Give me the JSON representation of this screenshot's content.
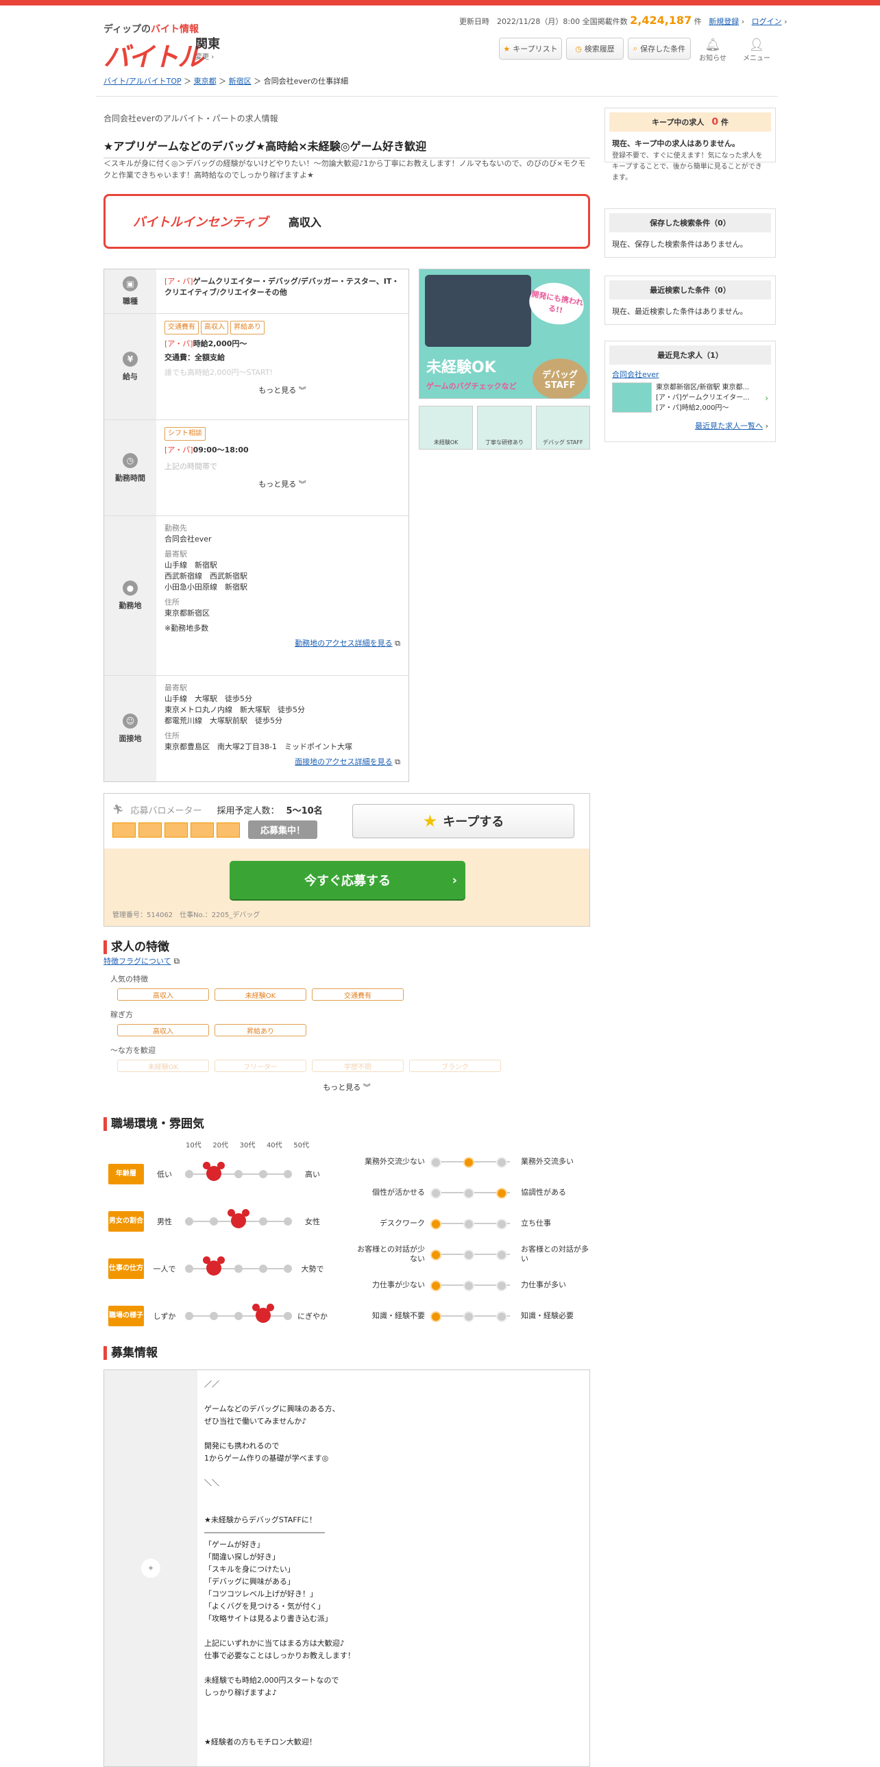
{
  "header": {
    "logo_sub_prefix": "ディップの",
    "logo_sub_accent": "バイト情報",
    "logo": "バイトル",
    "region": "関東",
    "region_change": "変更",
    "update_label": "更新日時　2022/11/28（月）8:00 全国掲載件数",
    "job_count": "2,424,187",
    "count_unit": "件",
    "register": "新規登録",
    "login": "ログイン",
    "btn_keeplist": "キープリスト",
    "btn_history": "検索履歴",
    "btn_saved": "保存した条件",
    "notify": "お知らせ",
    "menu": "メニュー"
  },
  "breadcrumb": {
    "top": "バイト/アルバイトTOP",
    "pref": "東京都",
    "ward": "新宿区",
    "current": "合同会社everの仕事詳細"
  },
  "job": {
    "company_sub": "合同会社everのアルバイト・パートの求人情報",
    "title": "★アプリゲームなどのデバッグ★高時給×未経験◎ゲーム好き歓迎",
    "description": "＜スキルが身に付く◎＞デバッグの経験がないけどやりたい！～勿論大歓迎♪1から丁寧にお教えします！ノルマもないので、のびのび×モクモクと作業できちゃいます！高時給なのでしっかり稼げますよ★",
    "banner_logo": "バイトルインセンティブ",
    "banner_text": "高収入"
  },
  "table": {
    "job_label": "職種",
    "job_type_tag": "[ア・パ]",
    "job_value": "ゲームクリエイター・デバッグ/デバッガー・テスター、IT・クリエイティブ/クリエイターその他",
    "pay_label": "給与",
    "pay_tags": [
      "交通費有",
      "高収入",
      "昇給あり"
    ],
    "pay_type": "[ア・パ]",
    "pay_value": "時給2,000円～",
    "pay_transport": "交通費：全額支給",
    "pay_faded": "誰でも高時給2,000円～START!",
    "more": "もっと見る",
    "time_label": "勤務時間",
    "time_tag": "シフト相談",
    "time_type": "[ア・パ]",
    "time_value": "09:00～18:00",
    "time_faded": "上記の時間帯で",
    "place_label": "勤務地",
    "place_sub1": "勤務先",
    "place_company": "合同会社ever",
    "place_sub2": "最寄駅",
    "place_station1": "山手線　新宿駅",
    "place_station2": "西武新宿線　西武新宿駅",
    "place_station3": "小田急小田原線　新宿駅",
    "place_sub3": "住所",
    "place_address": "東京都新宿区",
    "place_note": "※勤務地多数",
    "place_access": "勤務地のアクセス詳細を見る",
    "interview_label": "面接地",
    "iv_sub1": "最寄駅",
    "iv_station1": "山手線　大塚駅　徒歩5分",
    "iv_station2": "東京メトロ丸ノ内線　新大塚駅　徒歩5分",
    "iv_station3": "都電荒川線　大塚駅前駅　徒歩5分",
    "iv_sub2": "住所",
    "iv_address": "東京都豊島区　南大塚2丁目38-1　ミッドポイント大塚",
    "iv_access": "面接地のアクセス詳細を見る"
  },
  "gallery": {
    "badge": "開発にも携われる!!",
    "headline": "未経験OK",
    "caption": "ゲームのバグチェックなど",
    "staff": "デバッグ STAFF",
    "thumbs": [
      "未経験OK",
      "丁寧な研修あり",
      "デバッグ STAFF"
    ]
  },
  "apply": {
    "meter_label": "応募バロメーター",
    "planned_label": "採用予定人数：",
    "planned_value": "5～10名",
    "status": "応募集中！",
    "keep": "キープする",
    "apply": "今すぐ応募する",
    "mgmt": "管理番号：514062　仕事No.：2205_デバッグ"
  },
  "features": {
    "heading": "求人の特徴",
    "link": "特徴フラグについて",
    "group1": "人気の特徴",
    "group1_tags": [
      "高収入",
      "未経験OK",
      "交通費有"
    ],
    "group2": "稼ぎ方",
    "group2_tags": [
      "高収入",
      "昇給あり"
    ],
    "group3": "～な方を歓迎",
    "group3_tags": [
      "未経験OK",
      "フリーター",
      "学歴不問",
      "ブランク"
    ],
    "more": "もっと見る"
  },
  "environment": {
    "heading": "職場環境・雰囲気",
    "ages": [
      "10代",
      "20代",
      "30代",
      "40代",
      "50代"
    ],
    "rows": [
      {
        "label": "年齢層",
        "left": "低い",
        "right": "高い",
        "pos": 1
      },
      {
        "label": "男女の割合",
        "left": "男性",
        "right": "女性",
        "pos": 2
      },
      {
        "label": "仕事の仕方",
        "left": "一人で",
        "right": "大勢で",
        "pos": 1
      },
      {
        "label": "職場の様子",
        "left": "しずか",
        "right": "にぎやか",
        "pos": 3
      }
    ],
    "pairs": [
      {
        "left": "業務外交流少ない",
        "right": "業務外交流多い",
        "pos": 1
      },
      {
        "left": "個性が活かせる",
        "right": "協調性がある",
        "pos": 2
      },
      {
        "left": "デスクワーク",
        "right": "立ち仕事",
        "pos": 0
      },
      {
        "left": "お客様との対話が少ない",
        "right": "お客様との対話が多い",
        "pos": 0
      },
      {
        "left": "力仕事が少ない",
        "right": "力仕事が多い",
        "pos": 0
      },
      {
        "left": "知識・経験不要",
        "right": "知識・経験必要",
        "pos": 0
      }
    ]
  },
  "recruit": {
    "heading": "募集情報",
    "body": "／／\n\nゲームなどのデバッグに興味のある方、\nぜひ当社で働いてみませんか♪\n\n開発にも携われるので\n1からゲーム作りの基礎が学べます◎\n\n＼＼\n\n\n★未経験からデバッグSTAFFに！\n――――――――――――――――\n「ゲームが好き」\n「間違い探しが好き」\n「スキルを身につけたい」\n「デバッグに興味がある」\n「コツコツレベル上げが好き！」\n「よくバグを見つける・気が付く」\n「攻略サイトは見るより書き込む派」\n\n上記にいずれかに当てはまる方は大歓迎♪\n仕事で必要なことはしっかりお教えします！\n\n未経験でも時給2,000円スタートなので\nしっかり稼げますよ♪\n\n\n\n★経験者の方もモチロン大歓迎！"
  },
  "sidebar": {
    "keep_title": "キープ中の求人",
    "keep_count": "0",
    "keep_unit": "件",
    "keep_now": "現在、キープ中の求人はありません。",
    "keep_desc": "登録不要で、すぐに使えます！気になった求人をキープすることで、後から簡単に見ることができます。",
    "saved_title": "保存した検索条件（0）",
    "saved_text": "現在、保存した検索条件はありません。",
    "recent_search_title": "最近検索した条件（0）",
    "recent_search_text": "現在、最近検索した条件はありません。",
    "recent_view_title": "最近見た求人（1）",
    "recent_company": "合同会社ever",
    "recent_loc": "東京都新宿区/新宿駅 東京都...",
    "recent_job": "[ア・パ]ゲームクリエイター...",
    "recent_pay": "[ア・パ]時給2,000円～",
    "recent_all": "最近見た求人一覧へ"
  }
}
